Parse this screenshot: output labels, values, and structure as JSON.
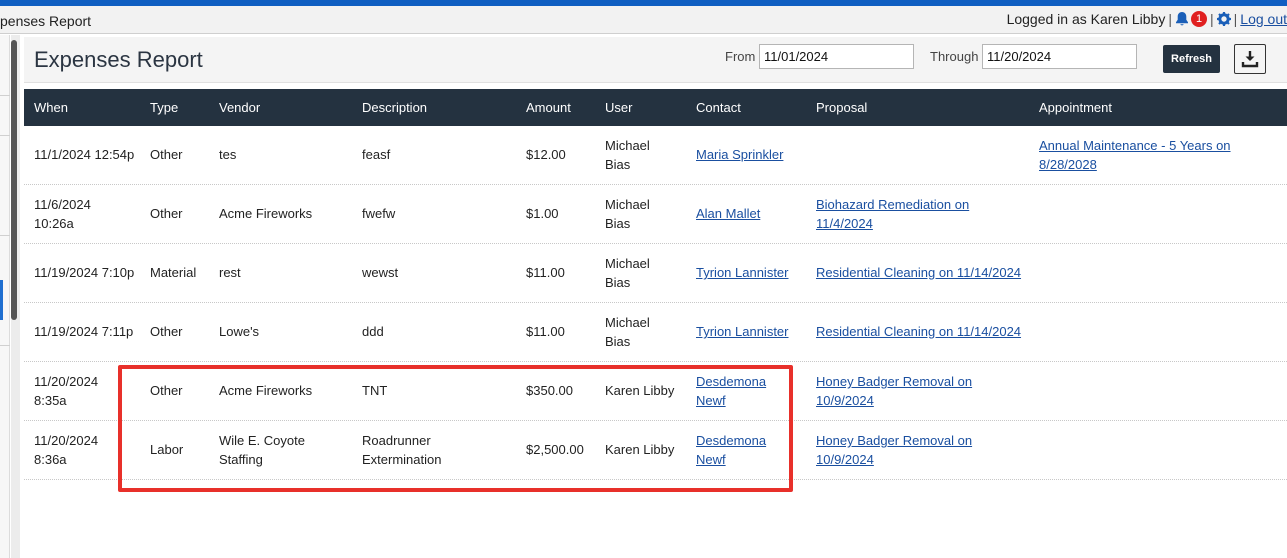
{
  "window": {
    "title": "penses Report"
  },
  "userbar": {
    "logged_in_text": "Logged in as Karen Libby",
    "sep1": "|",
    "sep2": "|",
    "sep3": "|",
    "notification_count": "1",
    "logout_label": "Log out"
  },
  "header": {
    "title": "Expenses Report",
    "from_label": "From",
    "from_value": "11/01/2024",
    "through_label": "Through",
    "through_value": "11/20/2024",
    "refresh_label": "Refresh"
  },
  "columns": [
    "When",
    "Type",
    "Vendor",
    "Description",
    "Amount",
    "User",
    "Contact",
    "Proposal",
    "Appointment"
  ],
  "rows": [
    {
      "when": [
        "11/1/2024 12:54p",
        ""
      ],
      "type": "Other",
      "vendor": [
        "tes",
        ""
      ],
      "description": [
        "feasf",
        ""
      ],
      "amount": "$12.00",
      "user": [
        "Michael",
        "Bias"
      ],
      "contact": [
        "Maria Sprinkler",
        ""
      ],
      "proposal": [
        "",
        ""
      ],
      "appointment": [
        "Annual Maintenance - 5 Years on",
        "8/28/2028"
      ]
    },
    {
      "when": [
        "11/6/2024",
        "10:26a"
      ],
      "type": "Other",
      "vendor": [
        "Acme Fireworks",
        ""
      ],
      "description": [
        "fwefw",
        ""
      ],
      "amount": "$1.00",
      "user": [
        "Michael",
        "Bias"
      ],
      "contact": [
        "Alan Mallet",
        ""
      ],
      "proposal": [
        "Biohazard Remediation on",
        "11/4/2024"
      ],
      "appointment": [
        "",
        ""
      ]
    },
    {
      "when": [
        "11/19/2024 7:10p",
        ""
      ],
      "type": "Material",
      "vendor": [
        "rest",
        ""
      ],
      "description": [
        "wewst",
        ""
      ],
      "amount": "$11.00",
      "user": [
        "Michael",
        "Bias"
      ],
      "contact": [
        "Tyrion Lannister",
        ""
      ],
      "proposal": [
        "Residential Cleaning on 11/14/2024",
        ""
      ],
      "appointment": [
        "",
        ""
      ]
    },
    {
      "when": [
        "11/19/2024 7:11p",
        ""
      ],
      "type": "Other",
      "vendor": [
        "Lowe's",
        ""
      ],
      "description": [
        "ddd",
        ""
      ],
      "amount": "$11.00",
      "user": [
        "Michael",
        "Bias"
      ],
      "contact": [
        "Tyrion Lannister",
        ""
      ],
      "proposal": [
        "Residential Cleaning on 11/14/2024",
        ""
      ],
      "appointment": [
        "",
        ""
      ]
    },
    {
      "when": [
        "11/20/2024",
        "8:35a"
      ],
      "type": "Other",
      "vendor": [
        "Acme Fireworks",
        ""
      ],
      "description": [
        "TNT",
        ""
      ],
      "amount": "$350.00",
      "user": [
        "Karen Libby",
        ""
      ],
      "contact": [
        "Desdemona",
        "Newf"
      ],
      "proposal": [
        "Honey Badger Removal on",
        "10/9/2024"
      ],
      "appointment": [
        "",
        ""
      ]
    },
    {
      "when": [
        "11/20/2024",
        "8:36a"
      ],
      "type": "Labor",
      "vendor": [
        "Wile E. Coyote",
        "Staffing"
      ],
      "description": [
        "Roadrunner",
        "Extermination"
      ],
      "amount": "$2,500.00",
      "user": [
        "Karen Libby",
        ""
      ],
      "contact": [
        "Desdemona",
        "Newf"
      ],
      "proposal": [
        "Honey Badger Removal on",
        "10/9/2024"
      ],
      "appointment": [
        "",
        ""
      ]
    }
  ],
  "colors": {
    "accent": "#243240",
    "link": "#1a4fa0",
    "highlight": "#e8302a",
    "badge": "#e02020"
  },
  "icons": [
    "bell-icon",
    "gear-icon",
    "download-icon"
  ]
}
